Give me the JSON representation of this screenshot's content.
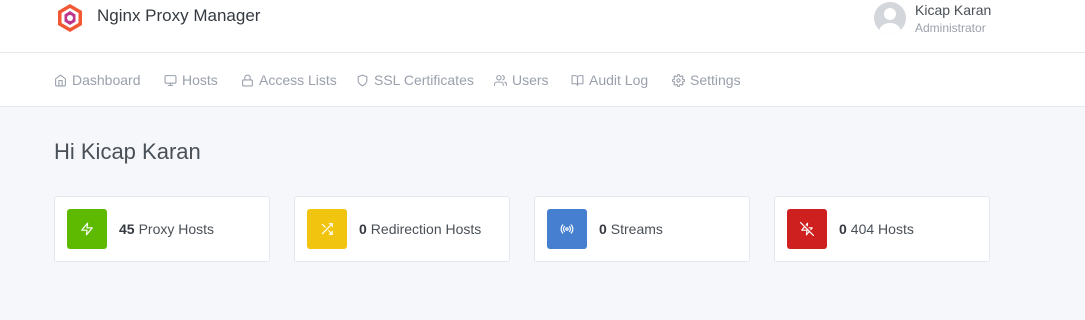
{
  "header": {
    "app_title": "Nginx Proxy Manager",
    "user_name": "Kicap Karan",
    "user_role": "Administrator",
    "logo_icon": "nginx-proxy-manager-logo"
  },
  "nav": {
    "items": [
      {
        "label": "Dashboard",
        "icon": "home-icon"
      },
      {
        "label": "Hosts",
        "icon": "monitor-icon"
      },
      {
        "label": "Access Lists",
        "icon": "lock-icon"
      },
      {
        "label": "SSL Certificates",
        "icon": "shield-icon"
      },
      {
        "label": "Users",
        "icon": "users-icon"
      },
      {
        "label": "Audit Log",
        "icon": "book-icon"
      },
      {
        "label": "Settings",
        "icon": "gear-icon"
      }
    ]
  },
  "main": {
    "greeting": "Hi Kicap Karan",
    "cards": [
      {
        "count": "45",
        "label": "Proxy Hosts",
        "icon": "zap-icon",
        "color": "#5eba00"
      },
      {
        "count": "0",
        "label": "Redirection Hosts",
        "icon": "shuffle-icon",
        "color": "#f1c40f"
      },
      {
        "count": "0",
        "label": "Streams",
        "icon": "radio-icon",
        "color": "#467fcf"
      },
      {
        "count": "0",
        "label": "404 Hosts",
        "icon": "zap-off-icon",
        "color": "#cd201f"
      }
    ]
  }
}
